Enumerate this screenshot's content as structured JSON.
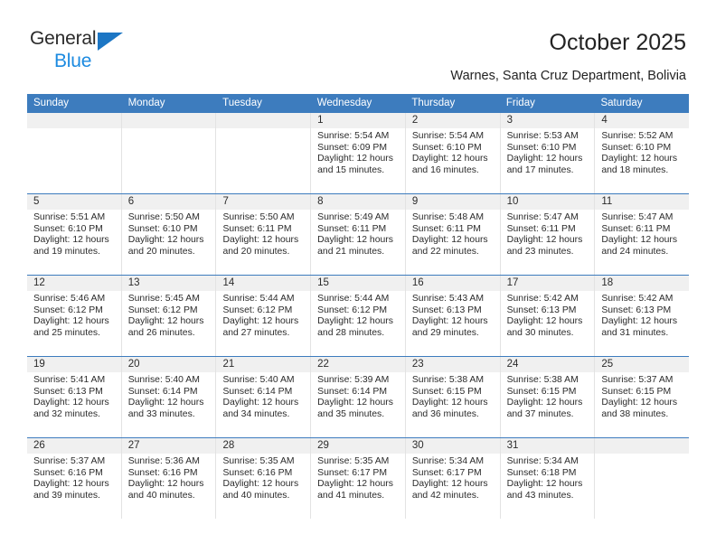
{
  "brand": {
    "name_top": "General",
    "name_bottom": "Blue",
    "triangle_color": "#1c76c4",
    "blue_text_color": "#1c8ae0"
  },
  "header": {
    "title": "October 2025",
    "subtitle": "Warnes, Santa Cruz Department, Bolivia"
  },
  "theme": {
    "header_blue": "#3d7cbe",
    "daynum_band": "#f0f0f0",
    "text": "#2b2b2b",
    "column_divider": "#e3e3e3"
  },
  "calendar": {
    "weekday_headers": [
      "Sunday",
      "Monday",
      "Tuesday",
      "Wednesday",
      "Thursday",
      "Friday",
      "Saturday"
    ],
    "weeks": [
      [
        {
          "day": "",
          "empty": true
        },
        {
          "day": "",
          "empty": true
        },
        {
          "day": "",
          "empty": true
        },
        {
          "day": "1",
          "sunrise": "Sunrise: 5:54 AM",
          "sunset": "Sunset: 6:09 PM",
          "daylight1": "Daylight: 12 hours",
          "daylight2": "and 15 minutes."
        },
        {
          "day": "2",
          "sunrise": "Sunrise: 5:54 AM",
          "sunset": "Sunset: 6:10 PM",
          "daylight1": "Daylight: 12 hours",
          "daylight2": "and 16 minutes."
        },
        {
          "day": "3",
          "sunrise": "Sunrise: 5:53 AM",
          "sunset": "Sunset: 6:10 PM",
          "daylight1": "Daylight: 12 hours",
          "daylight2": "and 17 minutes."
        },
        {
          "day": "4",
          "sunrise": "Sunrise: 5:52 AM",
          "sunset": "Sunset: 6:10 PM",
          "daylight1": "Daylight: 12 hours",
          "daylight2": "and 18 minutes."
        }
      ],
      [
        {
          "day": "5",
          "sunrise": "Sunrise: 5:51 AM",
          "sunset": "Sunset: 6:10 PM",
          "daylight1": "Daylight: 12 hours",
          "daylight2": "and 19 minutes."
        },
        {
          "day": "6",
          "sunrise": "Sunrise: 5:50 AM",
          "sunset": "Sunset: 6:10 PM",
          "daylight1": "Daylight: 12 hours",
          "daylight2": "and 20 minutes."
        },
        {
          "day": "7",
          "sunrise": "Sunrise: 5:50 AM",
          "sunset": "Sunset: 6:11 PM",
          "daylight1": "Daylight: 12 hours",
          "daylight2": "and 20 minutes."
        },
        {
          "day": "8",
          "sunrise": "Sunrise: 5:49 AM",
          "sunset": "Sunset: 6:11 PM",
          "daylight1": "Daylight: 12 hours",
          "daylight2": "and 21 minutes."
        },
        {
          "day": "9",
          "sunrise": "Sunrise: 5:48 AM",
          "sunset": "Sunset: 6:11 PM",
          "daylight1": "Daylight: 12 hours",
          "daylight2": "and 22 minutes."
        },
        {
          "day": "10",
          "sunrise": "Sunrise: 5:47 AM",
          "sunset": "Sunset: 6:11 PM",
          "daylight1": "Daylight: 12 hours",
          "daylight2": "and 23 minutes."
        },
        {
          "day": "11",
          "sunrise": "Sunrise: 5:47 AM",
          "sunset": "Sunset: 6:11 PM",
          "daylight1": "Daylight: 12 hours",
          "daylight2": "and 24 minutes."
        }
      ],
      [
        {
          "day": "12",
          "sunrise": "Sunrise: 5:46 AM",
          "sunset": "Sunset: 6:12 PM",
          "daylight1": "Daylight: 12 hours",
          "daylight2": "and 25 minutes."
        },
        {
          "day": "13",
          "sunrise": "Sunrise: 5:45 AM",
          "sunset": "Sunset: 6:12 PM",
          "daylight1": "Daylight: 12 hours",
          "daylight2": "and 26 minutes."
        },
        {
          "day": "14",
          "sunrise": "Sunrise: 5:44 AM",
          "sunset": "Sunset: 6:12 PM",
          "daylight1": "Daylight: 12 hours",
          "daylight2": "and 27 minutes."
        },
        {
          "day": "15",
          "sunrise": "Sunrise: 5:44 AM",
          "sunset": "Sunset: 6:12 PM",
          "daylight1": "Daylight: 12 hours",
          "daylight2": "and 28 minutes."
        },
        {
          "day": "16",
          "sunrise": "Sunrise: 5:43 AM",
          "sunset": "Sunset: 6:13 PM",
          "daylight1": "Daylight: 12 hours",
          "daylight2": "and 29 minutes."
        },
        {
          "day": "17",
          "sunrise": "Sunrise: 5:42 AM",
          "sunset": "Sunset: 6:13 PM",
          "daylight1": "Daylight: 12 hours",
          "daylight2": "and 30 minutes."
        },
        {
          "day": "18",
          "sunrise": "Sunrise: 5:42 AM",
          "sunset": "Sunset: 6:13 PM",
          "daylight1": "Daylight: 12 hours",
          "daylight2": "and 31 minutes."
        }
      ],
      [
        {
          "day": "19",
          "sunrise": "Sunrise: 5:41 AM",
          "sunset": "Sunset: 6:13 PM",
          "daylight1": "Daylight: 12 hours",
          "daylight2": "and 32 minutes."
        },
        {
          "day": "20",
          "sunrise": "Sunrise: 5:40 AM",
          "sunset": "Sunset: 6:14 PM",
          "daylight1": "Daylight: 12 hours",
          "daylight2": "and 33 minutes."
        },
        {
          "day": "21",
          "sunrise": "Sunrise: 5:40 AM",
          "sunset": "Sunset: 6:14 PM",
          "daylight1": "Daylight: 12 hours",
          "daylight2": "and 34 minutes."
        },
        {
          "day": "22",
          "sunrise": "Sunrise: 5:39 AM",
          "sunset": "Sunset: 6:14 PM",
          "daylight1": "Daylight: 12 hours",
          "daylight2": "and 35 minutes."
        },
        {
          "day": "23",
          "sunrise": "Sunrise: 5:38 AM",
          "sunset": "Sunset: 6:15 PM",
          "daylight1": "Daylight: 12 hours",
          "daylight2": "and 36 minutes."
        },
        {
          "day": "24",
          "sunrise": "Sunrise: 5:38 AM",
          "sunset": "Sunset: 6:15 PM",
          "daylight1": "Daylight: 12 hours",
          "daylight2": "and 37 minutes."
        },
        {
          "day": "25",
          "sunrise": "Sunrise: 5:37 AM",
          "sunset": "Sunset: 6:15 PM",
          "daylight1": "Daylight: 12 hours",
          "daylight2": "and 38 minutes."
        }
      ],
      [
        {
          "day": "26",
          "sunrise": "Sunrise: 5:37 AM",
          "sunset": "Sunset: 6:16 PM",
          "daylight1": "Daylight: 12 hours",
          "daylight2": "and 39 minutes."
        },
        {
          "day": "27",
          "sunrise": "Sunrise: 5:36 AM",
          "sunset": "Sunset: 6:16 PM",
          "daylight1": "Daylight: 12 hours",
          "daylight2": "and 40 minutes."
        },
        {
          "day": "28",
          "sunrise": "Sunrise: 5:35 AM",
          "sunset": "Sunset: 6:16 PM",
          "daylight1": "Daylight: 12 hours",
          "daylight2": "and 40 minutes."
        },
        {
          "day": "29",
          "sunrise": "Sunrise: 5:35 AM",
          "sunset": "Sunset: 6:17 PM",
          "daylight1": "Daylight: 12 hours",
          "daylight2": "and 41 minutes."
        },
        {
          "day": "30",
          "sunrise": "Sunrise: 5:34 AM",
          "sunset": "Sunset: 6:17 PM",
          "daylight1": "Daylight: 12 hours",
          "daylight2": "and 42 minutes."
        },
        {
          "day": "31",
          "sunrise": "Sunrise: 5:34 AM",
          "sunset": "Sunset: 6:18 PM",
          "daylight1": "Daylight: 12 hours",
          "daylight2": "and 43 minutes."
        },
        {
          "day": "",
          "empty": true
        }
      ]
    ]
  }
}
